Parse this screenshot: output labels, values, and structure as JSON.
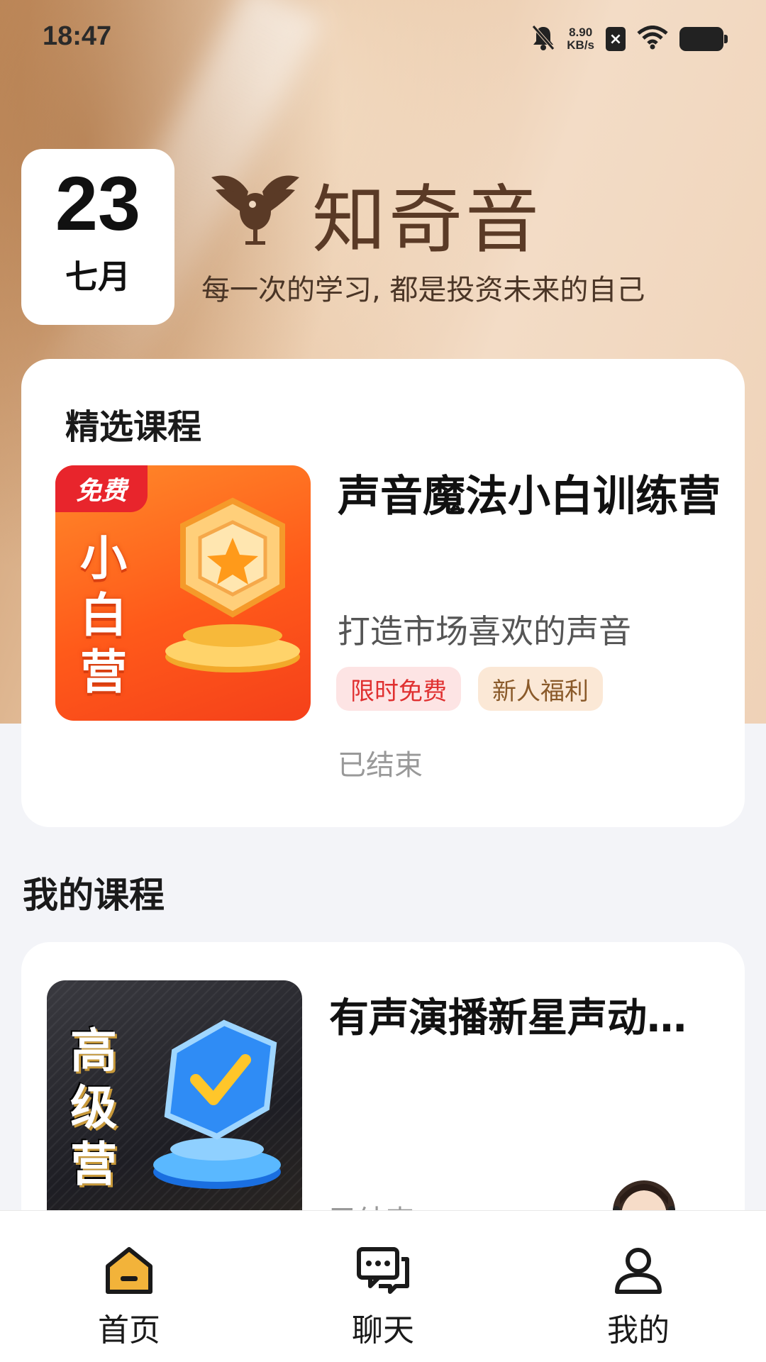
{
  "status_bar": {
    "time": "18:47",
    "net_speed_value": "8.90",
    "net_speed_unit": "KB/s",
    "icons": [
      "bell-mute-icon",
      "sim-icon",
      "wifi-icon",
      "battery-icon"
    ]
  },
  "header": {
    "date_day": "23",
    "date_month": "七月",
    "brand_name": "知奇音",
    "slogan": "每一次的学习, 都是投资未来的自己"
  },
  "featured": {
    "section_title": "精选课程",
    "thumb_badge": "免费",
    "thumb_text": "小白营",
    "course_name": "声音魔法小白训练营",
    "course_sub": "打造市场喜欢的声音",
    "tags": [
      "限时免费",
      "新人福利"
    ],
    "status": "已结束"
  },
  "my_courses": {
    "section_title": "我的课程",
    "thumb_text": "高级营",
    "course_name": "有声演播新星声动…",
    "status": "已结束"
  },
  "bottom_nav": {
    "items": [
      {
        "label": "首页",
        "icon": "home-icon"
      },
      {
        "label": "聊天",
        "icon": "chat-icon"
      },
      {
        "label": "我的",
        "icon": "profile-icon"
      }
    ]
  },
  "colors": {
    "accent_red": "#e03030",
    "accent_gold": "#8a5a2a",
    "brand_brown": "#5a3a26"
  }
}
